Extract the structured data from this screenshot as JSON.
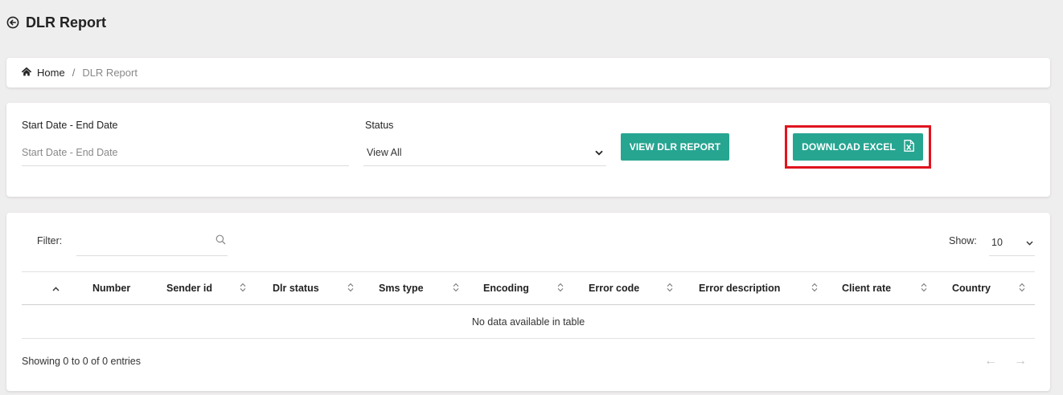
{
  "header": {
    "title": "DLR Report",
    "back_icon": "arrow-circle-left-icon"
  },
  "breadcrumb": {
    "home": "Home",
    "separator": "/",
    "current": "DLR Report",
    "home_icon": "home-icon"
  },
  "filters": {
    "date_label": "Start Date - End Date",
    "date_placeholder": "Start Date - End Date",
    "status_label": "Status",
    "status_value": "View All",
    "view_button": "VIEW DLR REPORT",
    "download_button": "DOWNLOAD EXCEL",
    "download_icon": "excel-file-icon",
    "accent_color": "#26a591",
    "highlight_color": "#e0141e"
  },
  "table": {
    "filter_label": "Filter:",
    "show_label": "Show:",
    "show_value": "10",
    "columns": [
      "Number",
      "Sender id",
      "Dlr status",
      "Sms type",
      "Encoding",
      "Error code",
      "Error description",
      "Client rate",
      "Country"
    ],
    "empty_message": "No data available in table",
    "info": "Showing 0 to 0 of 0 entries",
    "prev": "←",
    "next": "→"
  }
}
